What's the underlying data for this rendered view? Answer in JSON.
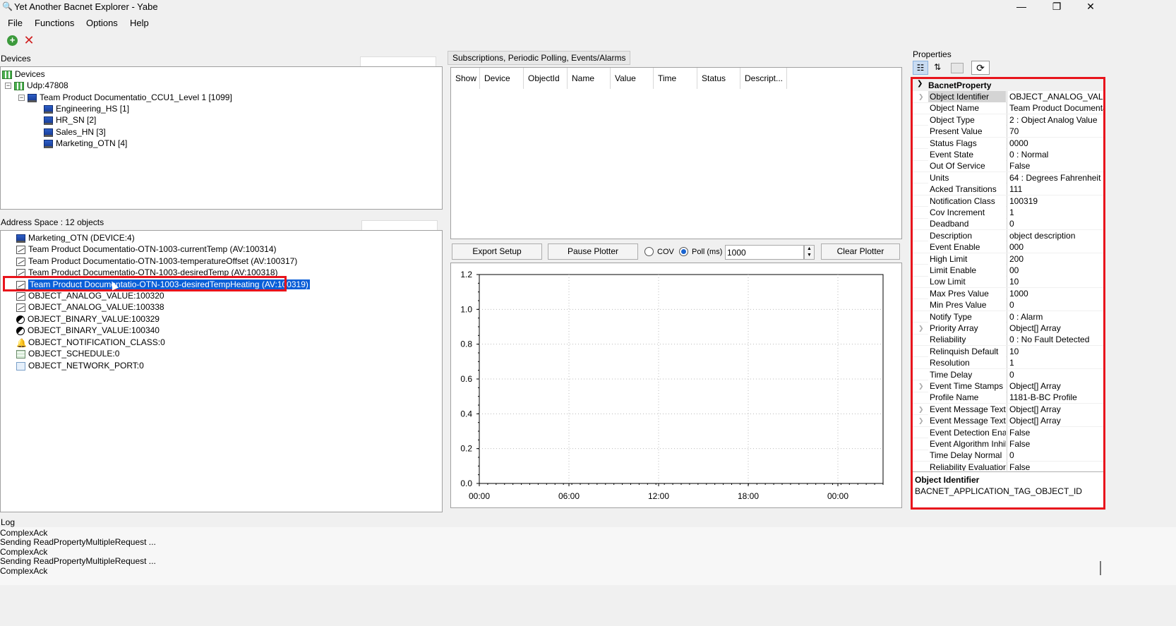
{
  "window": {
    "title": "Yet Another Bacnet Explorer - Yabe",
    "controls": [
      "—",
      "❐",
      "✕"
    ]
  },
  "menu": [
    "File",
    "Functions",
    "Options",
    "Help"
  ],
  "devices_panel": {
    "label": "Devices",
    "tree": [
      {
        "text": "Devices",
        "icon": "network-icon",
        "level": 0
      },
      {
        "text": "Udp:47808",
        "icon": "network-icon",
        "level": 1
      },
      {
        "text": "Team Product Documentatio_CCU1_Level 1 [1099]",
        "icon": "computer-icon",
        "level": 2
      },
      {
        "text": "Engineering_HS [1]",
        "icon": "computer-icon",
        "level": 3
      },
      {
        "text": "HR_SN [2]",
        "icon": "computer-icon",
        "level": 3
      },
      {
        "text": "Sales_HN [3]",
        "icon": "computer-icon",
        "level": 3
      },
      {
        "text": "Marketing_OTN [4]",
        "icon": "computer-icon",
        "level": 3
      }
    ]
  },
  "address_space": {
    "label": "Address Space : 12 objects",
    "items": [
      {
        "text": "Marketing_OTN (DEVICE:4)",
        "icon": "computer-icon"
      },
      {
        "text": "Team Product Documentatio-OTN-1003-currentTemp (AV:100314)",
        "icon": "analog-value-icon"
      },
      {
        "text": "Team Product Documentatio-OTN-1003-temperatureOffset (AV:100317)",
        "icon": "analog-value-icon"
      },
      {
        "text": "Team Product Documentatio-OTN-1003-desiredTemp (AV:100318)",
        "icon": "analog-value-icon"
      },
      {
        "text": "Team Product Documentatio-OTN-1003-desiredTempHeating (AV:100319)",
        "icon": "analog-value-icon",
        "selected": true
      },
      {
        "text": "OBJECT_ANALOG_VALUE:100320",
        "icon": "analog-value-icon"
      },
      {
        "text": "OBJECT_ANALOG_VALUE:100338",
        "icon": "analog-value-icon"
      },
      {
        "text": "OBJECT_BINARY_VALUE:100329",
        "icon": "binary-value-icon"
      },
      {
        "text": "OBJECT_BINARY_VALUE:100340",
        "icon": "binary-value-icon"
      },
      {
        "text": "OBJECT_NOTIFICATION_CLASS:0",
        "icon": "bell-icon"
      },
      {
        "text": "OBJECT_SCHEDULE:0",
        "icon": "schedule-icon"
      },
      {
        "text": "OBJECT_NETWORK_PORT:0",
        "icon": "network-port-icon"
      }
    ]
  },
  "subscriptions": {
    "label": "Subscriptions, Periodic Polling, Events/Alarms",
    "columns": [
      "Show",
      "Device",
      "ObjectId",
      "Name",
      "Value",
      "Time",
      "Status",
      "Descript..."
    ]
  },
  "plotter_controls": {
    "export_label": "Export Setup",
    "pause_label": "Pause Plotter",
    "cov_label": "COV",
    "poll_label": "Poll (ms)",
    "poll_value": "1000",
    "clear_label": "Clear Plotter"
  },
  "chart_data": {
    "type": "line",
    "x_ticks": [
      "00:00",
      "06:00",
      "12:00",
      "18:00",
      "00:00"
    ],
    "y_ticks": [
      "0.0",
      "0.2",
      "0.4",
      "0.6",
      "0.8",
      "1.0",
      "1.2"
    ],
    "ylim": [
      0,
      1.2
    ],
    "grid": true,
    "series": []
  },
  "properties": {
    "label": "Properties",
    "category": "BacnetProperty",
    "rows": [
      {
        "name": "Object Identifier",
        "value": "OBJECT_ANALOG_VALU",
        "expandable": true,
        "selected": true
      },
      {
        "name": "Object Name",
        "value": "Team Product Documenta"
      },
      {
        "name": "Object Type",
        "value": "2 : Object Analog Value"
      },
      {
        "name": "Present Value",
        "value": "70"
      },
      {
        "name": "Status Flags",
        "value": "0000"
      },
      {
        "name": "Event State",
        "value": "0 : Normal"
      },
      {
        "name": "Out Of Service",
        "value": "False"
      },
      {
        "name": "Units",
        "value": "64 : Degrees Fahrenheit"
      },
      {
        "name": "Acked Transitions",
        "value": "111"
      },
      {
        "name": "Notification Class",
        "value": "100319"
      },
      {
        "name": "Cov Increment",
        "value": "1"
      },
      {
        "name": "Deadband",
        "value": "0"
      },
      {
        "name": "Description",
        "value": "object description"
      },
      {
        "name": "Event Enable",
        "value": "000"
      },
      {
        "name": "High Limit",
        "value": "200"
      },
      {
        "name": "Limit Enable",
        "value": "00"
      },
      {
        "name": "Low Limit",
        "value": "10"
      },
      {
        "name": "Max Pres Value",
        "value": "1000"
      },
      {
        "name": "Min Pres Value",
        "value": "0"
      },
      {
        "name": "Notify Type",
        "value": "0 : Alarm"
      },
      {
        "name": "Priority Array",
        "value": "Object[] Array",
        "expandable": true
      },
      {
        "name": "Reliability",
        "value": "0 : No Fault Detected"
      },
      {
        "name": "Relinquish Default",
        "value": "10"
      },
      {
        "name": "Resolution",
        "value": "1"
      },
      {
        "name": "Time Delay",
        "value": "0"
      },
      {
        "name": "Event Time Stamps",
        "value": "Object[] Array",
        "expandable": true
      },
      {
        "name": "Profile Name",
        "value": "1181-B-BC Profile"
      },
      {
        "name": "Event Message Texts",
        "value": "Object[] Array",
        "expandable": true
      },
      {
        "name": "Event Message Texts",
        "value": "Object[] Array",
        "expandable": true
      },
      {
        "name": "Event Detection Enab",
        "value": "False"
      },
      {
        "name": "Event Algorithm Inhibi",
        "value": "False"
      },
      {
        "name": "Time Delay Normal",
        "value": "0"
      },
      {
        "name": "Reliability Evaluation I",
        "value": "False"
      }
    ],
    "description_title": "Object Identifier",
    "description_text": "BACNET_APPLICATION_TAG_OBJECT_ID"
  },
  "log": {
    "label": "Log",
    "lines": [
      "ComplexAck",
      "Sending ReadPropertyMultipleRequest ...",
      "ComplexAck",
      "Sending ReadPropertyMultipleRequest ...",
      "ComplexAck"
    ]
  },
  "colors": {
    "selection": "#0a5fd8",
    "highlight_border": "#e8141c"
  }
}
